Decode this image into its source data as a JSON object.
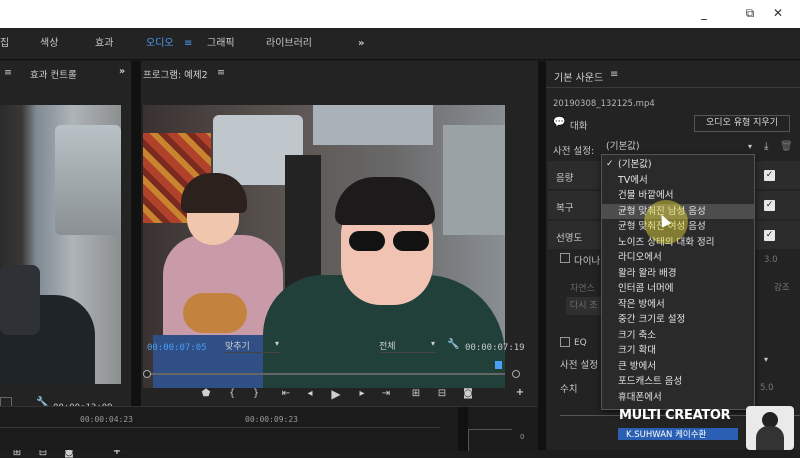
{
  "titlebar": {
    "minimize": "_",
    "maximize": "⧉",
    "close": "✕"
  },
  "workspaces": {
    "items": [
      "집",
      "색상",
      "효과",
      "오디오",
      "그래픽",
      "라이브러리"
    ],
    "active": "오디오",
    "more": "»",
    "menu": "≡"
  },
  "source": {
    "title": "효과 컨트롤",
    "more": "»",
    "timecode": "00;00;13;09"
  },
  "program": {
    "title": "프로그램: 예제2",
    "menu": "≡",
    "timecode_current": "00:00:07:05",
    "fit_label": "맞추기",
    "quality_label": "전체",
    "timecode_duration": "00:00:07:19"
  },
  "timeline": {
    "tc1": "00:00:04:23",
    "tc2": "00:00:09:23",
    "meter_zero": "0"
  },
  "essential_sound": {
    "title": "기본 사운드",
    "menu": "≡",
    "filename": "20190308_132125.mp4",
    "type_label": "대화",
    "clear_type_button": "오디오 유형 지우기",
    "preset_label": "사전 설정:",
    "preset_value": "(기본값)",
    "rows": [
      "음량",
      "복구",
      "선명도"
    ],
    "dynamics": "다이나",
    "value_30": "3.0",
    "faded_1": "자연스",
    "faded_2": "다시 조",
    "side_right": "강조",
    "eq_label": "EQ",
    "preset2_label": "사전 설정",
    "amount_label": "수치",
    "value_50": "5.0",
    "frame_icon": "▯"
  },
  "dropdown": {
    "items": [
      "(기본값)",
      "TV에서",
      "건물 바깥에서",
      "균형 맞춰진 남성 음성",
      "균형 맞춰진 여성 음성",
      "노이즈 상태의 대화 정리",
      "라디오에서",
      "왈라 왈라 배경",
      "인터콤 너머에",
      "작은 방에서",
      "중간 크기로 설정",
      "크기 축소",
      "크기 확대",
      "큰 방에서",
      "포드캐스트 음성",
      "휴대폰에서"
    ],
    "checked_index": 0,
    "highlighted_index": 3
  },
  "watermark": {
    "line1": "MULTI CREATOR",
    "line2": "K.SUHWAN 케이수환"
  }
}
